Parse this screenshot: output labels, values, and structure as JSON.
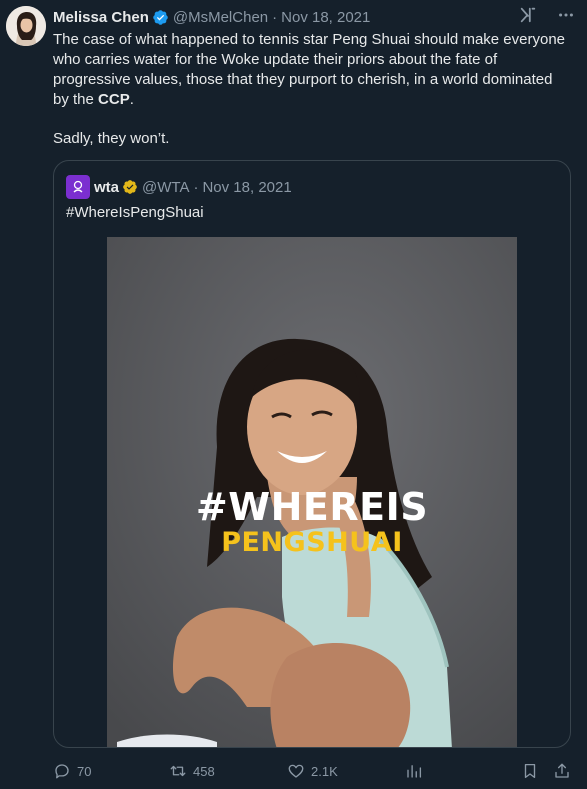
{
  "author": {
    "name": "Melissa Chen",
    "handle": "@MsMelChen",
    "separator": "·",
    "date": "Nov 18, 2021"
  },
  "tweet": {
    "text_main": "The case of what happened to tennis star Peng Shuai should make everyone who carries water for the Woke update their priors about the fate of progressive values, those that they purport to cherish, in a world dominated by the ",
    "text_bold": "CCP",
    "text_end": ".",
    "text_second": "Sadly, they won’t."
  },
  "quote": {
    "name": "wta",
    "handle": "@WTA",
    "separator": "·",
    "date": "Nov 18, 2021",
    "text": "#WhereIsPengShuai",
    "media_line1": "#WHEREIS",
    "media_line2": "PENGSHUAI"
  },
  "actions": {
    "replies": "70",
    "retweets": "458",
    "likes": "2.1K"
  },
  "colors": {
    "background": "#15202b",
    "verified_blue": "#1d9bf0",
    "verified_gold": "#e2b719",
    "wta_purple": "#7b2fd0",
    "overlay_yellow": "#f5c21c"
  }
}
